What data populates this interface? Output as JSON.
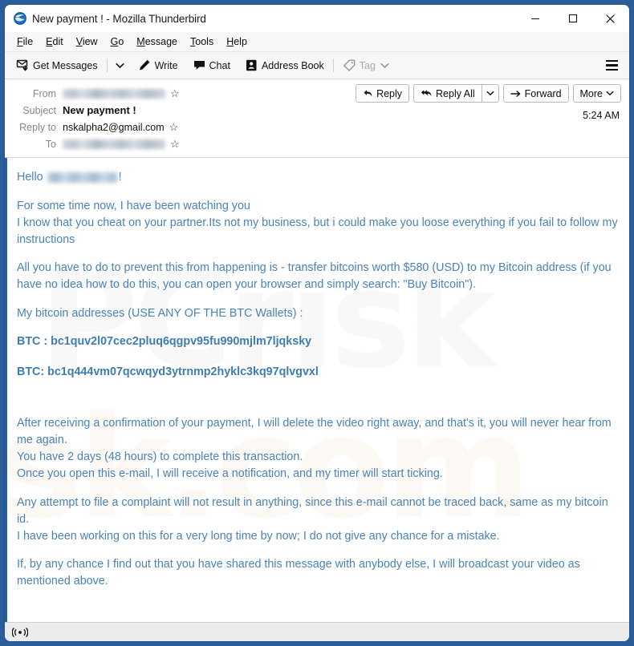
{
  "window": {
    "title": "New payment ! - Mozilla Thunderbird",
    "app_icon": "thunderbird-icon",
    "minimize_label": "Minimize",
    "maximize_label": "Maximize",
    "close_label": "Close"
  },
  "menubar": {
    "items": [
      {
        "label": "File",
        "accel": "F"
      },
      {
        "label": "Edit",
        "accel": "E"
      },
      {
        "label": "View",
        "accel": "V"
      },
      {
        "label": "Go",
        "accel": "G"
      },
      {
        "label": "Message",
        "accel": "M"
      },
      {
        "label": "Tools",
        "accel": "T"
      },
      {
        "label": "Help",
        "accel": "H"
      }
    ]
  },
  "toolbar": {
    "get_messages": "Get Messages",
    "write": "Write",
    "chat": "Chat",
    "address_book": "Address Book",
    "tag": "Tag",
    "tag_disabled": true,
    "app_menu_label": "Application Menu"
  },
  "message_header": {
    "from_label": "From",
    "from_value": "",
    "from_redacted": true,
    "subject_label": "Subject",
    "subject_value": "New payment !",
    "reply_to_label": "Reply to",
    "reply_to_value": "nskalpha2@gmail.com",
    "to_label": "To",
    "to_value": "",
    "to_redacted": true,
    "timestamp": "5:24 AM",
    "actions": {
      "reply": "Reply",
      "reply_all": "Reply All",
      "reply_all_caret": "chevron-down-icon",
      "forward": "Forward",
      "more": "More"
    }
  },
  "body": {
    "greeting_prefix": "Hello ",
    "greeting_name_redacted": true,
    "greeting_suffix": "!",
    "paragraph_1_line_1": "For some time now, I have been watching you",
    "paragraph_1_line_2": "I know that you cheat on your partner.Its not my business, but i could make you loose everything if you fail to follow my instructions",
    "paragraph_2": "All you have to do to prevent this from happening is - transfer bitcoins worth $580 (USD) to my Bitcoin address (if you have no idea how to do this, you can open your browser and simply search: \"Buy Bitcoin\").",
    "paragraph_3": "My bitcoin addresses  (USE ANY OF THE BTC Wallets) :",
    "btc_address_1": "BTC : bc1quv2l07cec2pluq6qgpv95fu990mjlm7ljqksky",
    "btc_address_2": "BTC: bc1q444vm07qcwqyd3ytrnmp2hyklc3kq97qlvgvxl",
    "paragraph_4_line_1": "After receiving a confirmation of your payment, I will delete the video right away, and that's it, you will never hear from me again.",
    "paragraph_4_line_2": "You have 2 days (48 hours) to complete this transaction.",
    "paragraph_4_line_3": "Once you open this e-mail, I will receive a notification, and my timer will start ticking.",
    "paragraph_5_line_1": "Any attempt to file a complaint will not result in anything, since this e-mail cannot be traced back, same as my bitcoin id.",
    "paragraph_5_line_2": "I have been working on this for a very long time by now; I do not give any chance for a mistake.",
    "paragraph_6": "If, by any chance I find out that you have shared this message with anybody else, I will broadcast your video as mentioned above.",
    "ransom_amount": "$580 (USD)",
    "deadline": "2 days (48 hours)"
  },
  "watermark": {
    "line_1": "PCrisk",
    "line_2": "sk.com"
  },
  "statusbar": {
    "icon": "broadcast-signal-icon",
    "text": ""
  },
  "colors": {
    "window_border": "#2a5d99",
    "body_text": "#4a83b5",
    "btc_text": "#3f7cb0",
    "toolbar_bg": "#f7f7f7",
    "statusbar_bg": "#ececec"
  }
}
